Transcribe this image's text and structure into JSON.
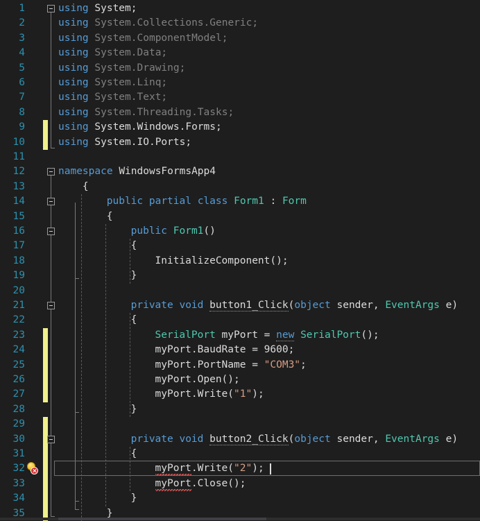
{
  "editor": {
    "language": "csharp",
    "theme": "dark",
    "background": "#1e1e1e",
    "foreground": "#dcdcdc",
    "line_number_color": "#2b91af",
    "keyword_color": "#569cd6",
    "type_color": "#4ec9b0",
    "string_color": "#d69d85",
    "dim_color": "#808080",
    "change_bar_color": "#f0f08c",
    "error_squiggle_color": "#e05a5a",
    "current_line": 32,
    "total_lines_visible": 35,
    "caret_line": 32,
    "caret_column": 33
  },
  "gutter": {
    "line_numbers": [
      "1",
      "2",
      "3",
      "4",
      "5",
      "6",
      "7",
      "8",
      "9",
      "10",
      "11",
      "12",
      "13",
      "14",
      "15",
      "16",
      "17",
      "18",
      "19",
      "20",
      "21",
      "22",
      "23",
      "24",
      "25",
      "26",
      "27",
      "28",
      "29",
      "30",
      "31",
      "32",
      "33",
      "34",
      "35"
    ],
    "changed_lines": [
      9,
      10,
      23,
      24,
      25,
      26,
      27,
      29,
      30,
      31,
      32,
      33,
      34,
      35
    ],
    "collapse_lines": [
      1,
      12,
      14,
      16,
      21,
      30
    ],
    "error_icon": {
      "line": 32,
      "name": "lightbulb-error-icon",
      "bulb_color": "#f2c230",
      "badge_color": "#d13438",
      "tooltip": "Error"
    }
  },
  "code_lines": [
    {
      "n": "1",
      "indent": 0,
      "tokens": [
        {
          "t": "using",
          "c": "kw"
        },
        {
          "t": " ",
          "c": "pln"
        },
        {
          "t": "System;",
          "c": "brt"
        }
      ]
    },
    {
      "n": "2",
      "indent": 0,
      "tokens": [
        {
          "t": "using",
          "c": "kw"
        },
        {
          "t": " ",
          "c": "pln"
        },
        {
          "t": "System.Collections.Generic;",
          "c": "dim"
        }
      ]
    },
    {
      "n": "3",
      "indent": 0,
      "tokens": [
        {
          "t": "using",
          "c": "kw"
        },
        {
          "t": " ",
          "c": "pln"
        },
        {
          "t": "System.ComponentModel;",
          "c": "dim"
        }
      ]
    },
    {
      "n": "4",
      "indent": 0,
      "tokens": [
        {
          "t": "using",
          "c": "kw"
        },
        {
          "t": " ",
          "c": "pln"
        },
        {
          "t": "System.Data;",
          "c": "dim"
        }
      ]
    },
    {
      "n": "5",
      "indent": 0,
      "tokens": [
        {
          "t": "using",
          "c": "kw"
        },
        {
          "t": " ",
          "c": "pln"
        },
        {
          "t": "System.Drawing;",
          "c": "dim"
        }
      ]
    },
    {
      "n": "6",
      "indent": 0,
      "tokens": [
        {
          "t": "using",
          "c": "kw"
        },
        {
          "t": " ",
          "c": "pln"
        },
        {
          "t": "System.Linq;",
          "c": "dim"
        }
      ]
    },
    {
      "n": "7",
      "indent": 0,
      "tokens": [
        {
          "t": "using",
          "c": "kw"
        },
        {
          "t": " ",
          "c": "pln"
        },
        {
          "t": "System.Text;",
          "c": "dim"
        }
      ]
    },
    {
      "n": "8",
      "indent": 0,
      "tokens": [
        {
          "t": "using",
          "c": "kw"
        },
        {
          "t": " ",
          "c": "pln"
        },
        {
          "t": "System.Threading.Tasks;",
          "c": "dim"
        }
      ]
    },
    {
      "n": "9",
      "indent": 0,
      "tokens": [
        {
          "t": "using",
          "c": "kw"
        },
        {
          "t": " ",
          "c": "pln"
        },
        {
          "t": "System.Windows.Forms;",
          "c": "brt"
        }
      ]
    },
    {
      "n": "10",
      "indent": 0,
      "tokens": [
        {
          "t": "using",
          "c": "kw"
        },
        {
          "t": " ",
          "c": "pln"
        },
        {
          "t": "System.IO.Ports;",
          "c": "brt"
        }
      ]
    },
    {
      "n": "11",
      "indent": 0,
      "tokens": []
    },
    {
      "n": "12",
      "indent": 0,
      "tokens": [
        {
          "t": "namespace",
          "c": "kw"
        },
        {
          "t": " ",
          "c": "pln"
        },
        {
          "t": "WindowsFormsApp4",
          "c": "pln"
        }
      ]
    },
    {
      "n": "13",
      "indent": 1,
      "tokens": [
        {
          "t": "{",
          "c": "pln"
        }
      ]
    },
    {
      "n": "14",
      "indent": 2,
      "tokens": [
        {
          "t": "public partial class",
          "c": "kw"
        },
        {
          "t": " ",
          "c": "pln"
        },
        {
          "t": "Form1",
          "c": "typ"
        },
        {
          "t": " : ",
          "c": "pln"
        },
        {
          "t": "Form",
          "c": "typ"
        }
      ]
    },
    {
      "n": "15",
      "indent": 2,
      "tokens": [
        {
          "t": "{",
          "c": "pln"
        }
      ]
    },
    {
      "n": "16",
      "indent": 3,
      "tokens": [
        {
          "t": "public",
          "c": "kw"
        },
        {
          "t": " ",
          "c": "pln"
        },
        {
          "t": "Form1",
          "c": "typ"
        },
        {
          "t": "()",
          "c": "pln"
        }
      ]
    },
    {
      "n": "17",
      "indent": 3,
      "tokens": [
        {
          "t": "{",
          "c": "pln"
        }
      ]
    },
    {
      "n": "18",
      "indent": 4,
      "tokens": [
        {
          "t": "InitializeComponent",
          "c": "pln"
        },
        {
          "t": "();",
          "c": "pln"
        }
      ]
    },
    {
      "n": "19",
      "indent": 3,
      "tokens": [
        {
          "t": "}",
          "c": "pln"
        }
      ]
    },
    {
      "n": "20",
      "indent": 0,
      "tokens": []
    },
    {
      "n": "21",
      "indent": 3,
      "tokens": [
        {
          "t": "private void",
          "c": "kw"
        },
        {
          "t": " ",
          "c": "pln"
        },
        {
          "t": "button1_Click",
          "c": "pln",
          "smart": true
        },
        {
          "t": "(",
          "c": "pln"
        },
        {
          "t": "object",
          "c": "kw"
        },
        {
          "t": " sender, ",
          "c": "pln"
        },
        {
          "t": "EventArgs",
          "c": "typ"
        },
        {
          "t": " e)",
          "c": "pln"
        }
      ]
    },
    {
      "n": "22",
      "indent": 3,
      "tokens": [
        {
          "t": "{",
          "c": "pln"
        }
      ]
    },
    {
      "n": "23",
      "indent": 4,
      "tokens": [
        {
          "t": "SerialPort",
          "c": "typ"
        },
        {
          "t": " myPort = ",
          "c": "pln"
        },
        {
          "t": "new",
          "c": "kw",
          "smart": true
        },
        {
          "t": " ",
          "c": "pln"
        },
        {
          "t": "SerialPort",
          "c": "typ"
        },
        {
          "t": "();",
          "c": "pln"
        }
      ]
    },
    {
      "n": "24",
      "indent": 4,
      "tokens": [
        {
          "t": "myPort.BaudRate = ",
          "c": "pln"
        },
        {
          "t": "9600",
          "c": "num"
        },
        {
          "t": ";",
          "c": "pln"
        }
      ]
    },
    {
      "n": "25",
      "indent": 4,
      "tokens": [
        {
          "t": "myPort.PortName = ",
          "c": "pln"
        },
        {
          "t": "\"COM3\"",
          "c": "str"
        },
        {
          "t": ";",
          "c": "pln"
        }
      ]
    },
    {
      "n": "26",
      "indent": 4,
      "tokens": [
        {
          "t": "myPort.Open();",
          "c": "pln"
        }
      ]
    },
    {
      "n": "27",
      "indent": 4,
      "tokens": [
        {
          "t": "myPort.Write(",
          "c": "pln"
        },
        {
          "t": "\"1\"",
          "c": "str"
        },
        {
          "t": ");",
          "c": "pln"
        }
      ]
    },
    {
      "n": "28",
      "indent": 3,
      "tokens": [
        {
          "t": "}",
          "c": "pln"
        }
      ]
    },
    {
      "n": "29",
      "indent": 0,
      "tokens": []
    },
    {
      "n": "30",
      "indent": 3,
      "tokens": [
        {
          "t": "private void",
          "c": "kw"
        },
        {
          "t": " ",
          "c": "pln"
        },
        {
          "t": "button2_Click",
          "c": "pln",
          "smart": true
        },
        {
          "t": "(",
          "c": "pln"
        },
        {
          "t": "object",
          "c": "kw"
        },
        {
          "t": " sender, ",
          "c": "pln"
        },
        {
          "t": "EventArgs",
          "c": "typ"
        },
        {
          "t": " e)",
          "c": "pln"
        }
      ]
    },
    {
      "n": "31",
      "indent": 3,
      "tokens": [
        {
          "t": "{",
          "c": "pln"
        }
      ]
    },
    {
      "n": "32",
      "indent": 4,
      "tokens": [
        {
          "t": "myPort",
          "c": "pln",
          "error": true
        },
        {
          "t": ".Write(",
          "c": "pln"
        },
        {
          "t": "\"2\"",
          "c": "str"
        },
        {
          "t": ");",
          "c": "pln"
        }
      ]
    },
    {
      "n": "33",
      "indent": 4,
      "tokens": [
        {
          "t": "myPort",
          "c": "pln",
          "error": true
        },
        {
          "t": ".Close();",
          "c": "pln"
        }
      ]
    },
    {
      "n": "34",
      "indent": 3,
      "tokens": [
        {
          "t": "}",
          "c": "pln"
        }
      ]
    },
    {
      "n": "35",
      "indent": 2,
      "tokens": [
        {
          "t": "}",
          "c": "pln"
        }
      ]
    }
  ],
  "errors": [
    {
      "line": 32,
      "symbol": "myPort",
      "severity": "error"
    },
    {
      "line": 33,
      "symbol": "myPort",
      "severity": "error"
    }
  ]
}
